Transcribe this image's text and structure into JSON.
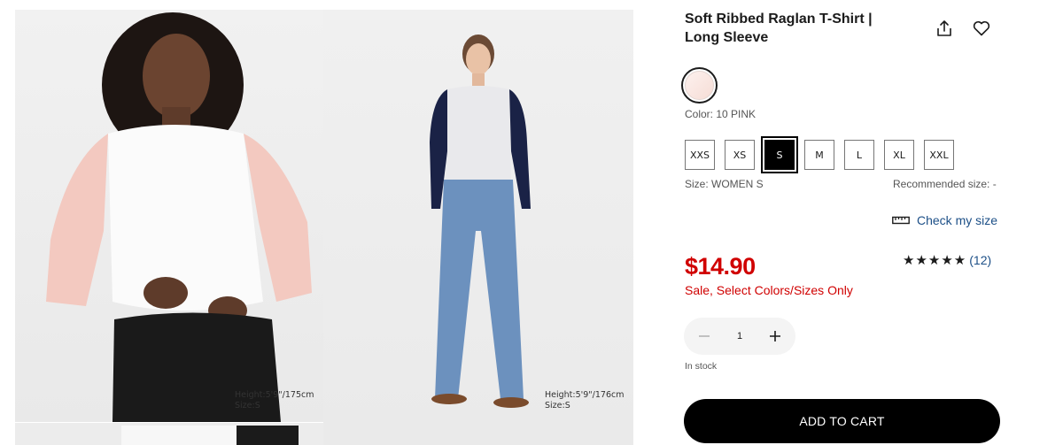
{
  "product": {
    "title": "Soft Ribbed Raglan T-Shirt | Long Sleeve",
    "color_label": "Color: 10 PINK",
    "swatch_color": "#f8e4de",
    "sizes": [
      "XXS",
      "XS",
      "S",
      "M",
      "L",
      "XL",
      "XXL"
    ],
    "selected_size": "S",
    "size_label": "Size: WOMEN S",
    "recommended_size": "Recommended size: -",
    "check_size_label": "Check my size",
    "price": "$14.90",
    "sale_text": "Sale,  Select Colors/Sizes Only",
    "rating_stars": "★★★★★",
    "rating_value": 5,
    "review_count": "(12)",
    "quantity": "1",
    "stock_status": "In stock",
    "add_to_cart_label": "ADD TO CART"
  },
  "gallery": {
    "image1_caption": {
      "height": "Height:5'9\"/175cm",
      "size": "Size:S"
    },
    "image2_caption": {
      "height": "Height:5'9\"/176cm",
      "size": "Size:S"
    }
  },
  "icons": {
    "share": "share-icon",
    "wishlist": "heart-icon",
    "ruler": "ruler-icon",
    "minus": "minus-icon",
    "plus": "plus-icon"
  },
  "colors": {
    "price_red": "#d00000",
    "link_blue": "#1c4f87",
    "button_black": "#000000",
    "raglan_pink": "#f3c9c0",
    "raglan_navy": "#1a2246"
  }
}
